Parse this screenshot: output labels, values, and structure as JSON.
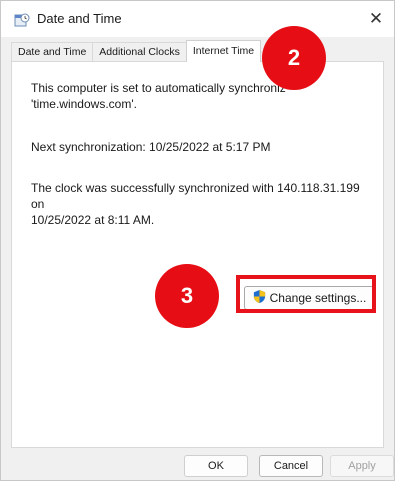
{
  "window": {
    "title": "Date and Time",
    "close_glyph": "✕"
  },
  "tabs": [
    {
      "label": "Date and Time"
    },
    {
      "label": "Additional Clocks"
    },
    {
      "label": "Internet Time"
    }
  ],
  "panel": {
    "sync_text_line1": "This computer is set to automatically synchroniz",
    "sync_text_line2": "'time.windows.com'.",
    "next_sync": "Next synchronization: 10/25/2022 at 5:17 PM",
    "status_line1": "The clock was successfully synchronized with 140.118.31.199 on",
    "status_line2": "10/25/2022 at 8:11 AM.",
    "change_settings_label": "Change settings..."
  },
  "annotations": {
    "marker_2": "2",
    "marker_3": "3",
    "highlight_color": "#e8121a"
  },
  "buttons": {
    "ok": "OK",
    "cancel": "Cancel",
    "apply": "Apply"
  }
}
